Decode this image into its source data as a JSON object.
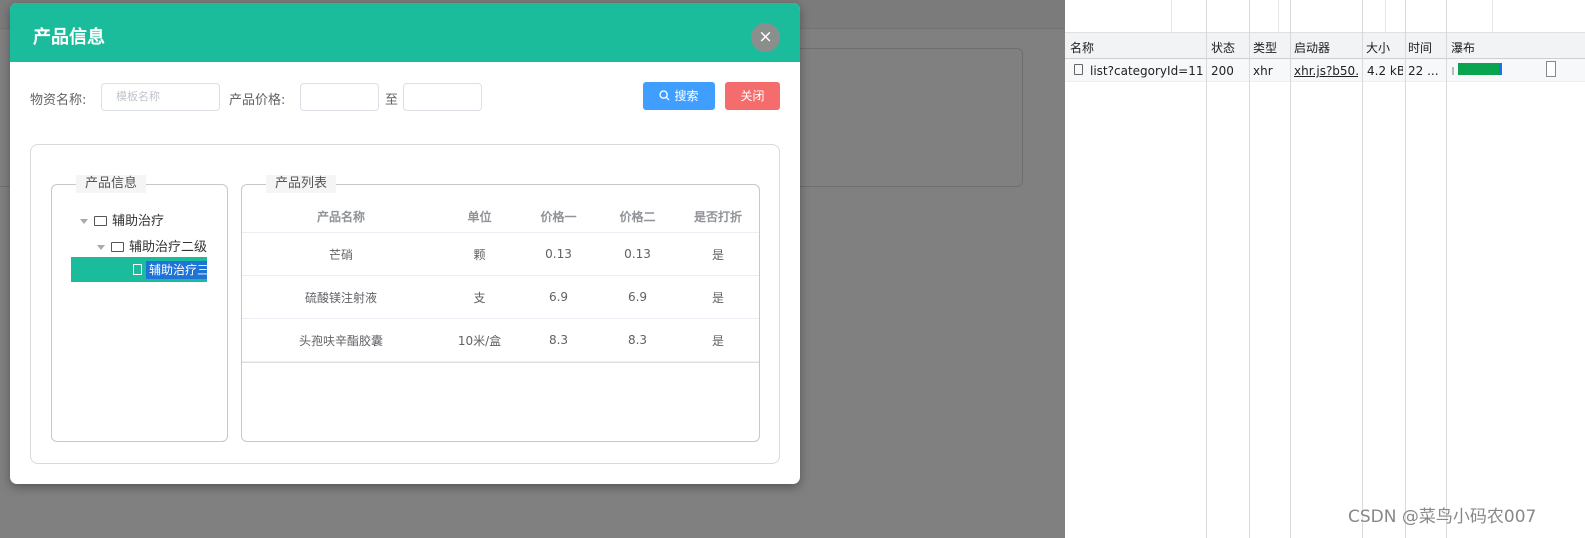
{
  "dialog": {
    "title": "产品信息",
    "close_glyph": "×",
    "search_form": {
      "material_label": "物资名称:",
      "material_placeholder": "模板名称",
      "price_label": "产品价格:",
      "to_label": "至",
      "search_button": "搜索",
      "close_button": "关闭"
    },
    "tree_panel": {
      "legend": "产品信息",
      "nodes": [
        "辅助治疗",
        "辅助治疗二级",
        "辅助治疗三"
      ]
    },
    "list_panel": {
      "legend": "产品列表",
      "headers": [
        "产品名称",
        "单位",
        "价格一",
        "价格二",
        "是否打折"
      ],
      "rows": [
        [
          "芒硝",
          "颗",
          "0.13",
          "0.13",
          "是"
        ],
        [
          "硫酸镁注射液",
          "支",
          "6.9",
          "6.9",
          "是"
        ],
        [
          "头孢呋辛酯胶囊",
          "10米/盒",
          "8.3",
          "8.3",
          "是"
        ]
      ]
    }
  },
  "devtools": {
    "headers": [
      "名称",
      "状态",
      "类型",
      "启动器",
      "大小",
      "时间",
      "瀑布"
    ],
    "request": {
      "name": "list?categoryId=11...",
      "status": "200",
      "type": "xhr",
      "initiator": "xhr.js?b50...",
      "size": "4.2 kB",
      "time": "22 ..."
    }
  },
  "watermark": "CSDN @菜鸟小码农007",
  "colors": {
    "header_teal": "#1abc9c",
    "search_blue": "#409eff",
    "close_red": "#f56c6c",
    "selection_blue": "#1e73d8",
    "waterfall_green": "#0aa34f"
  }
}
